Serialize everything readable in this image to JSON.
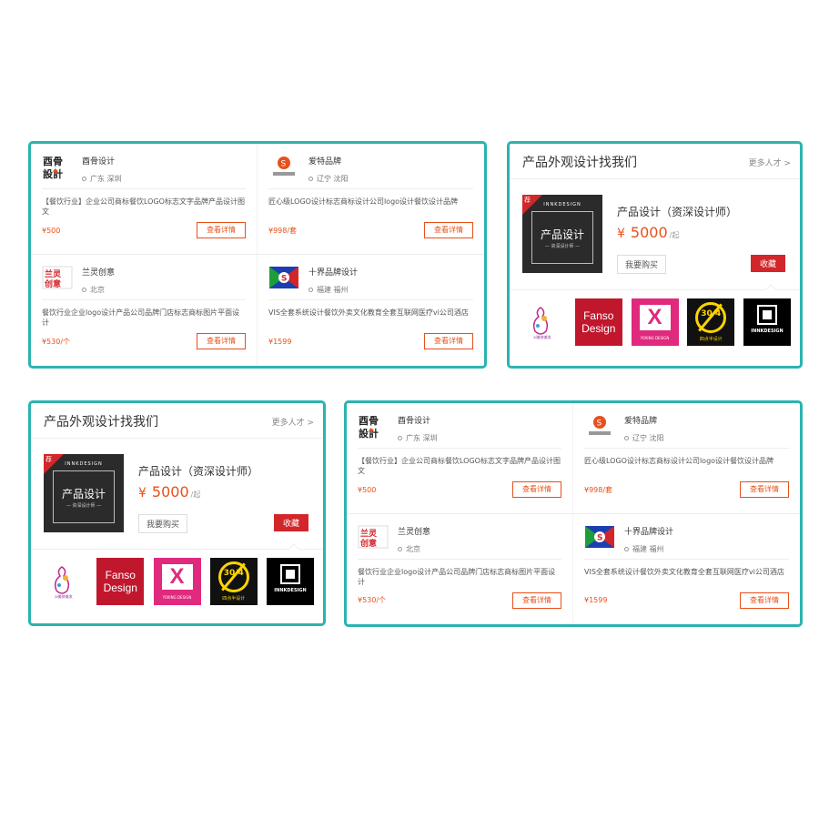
{
  "providers": [
    {
      "name": "酉骨设计",
      "location": "广东 深圳",
      "desc": "【餐饮行业】企业公司商标餐饮LOGO标志文字品牌产品设计图文",
      "price": "¥500",
      "button": "查看详情",
      "logo": "yougu-logo"
    },
    {
      "name": "爱特品牌",
      "location": "辽宁 沈阳",
      "desc": "匠心级LOGO设计标志商标设计公司logo设计餐饮设计品牌",
      "price": "¥998/套",
      "button": "查看详情",
      "logo": "aite-logo"
    },
    {
      "name": "兰灵创意",
      "location": "北京",
      "desc": "餐饮行业企业logo设计产品公司品牌门店标志商标图片平面设计",
      "price": "¥530/个",
      "button": "查看详情",
      "logo": "lanling-logo"
    },
    {
      "name": "十界品牌设计",
      "location": "福建 福州",
      "desc": "VIS全套系统设计餐饮外卖文化教育全套互联网医疗vi公司酒店",
      "price": "¥1599",
      "button": "查看详情",
      "logo": "shijie-logo"
    }
  ],
  "product_card": {
    "title": "产品外观设计找我们",
    "more": "更多人才 >",
    "thumb_tag": "荐",
    "thumb_brand": "INNKDESIGN",
    "thumb_main": "产品设计",
    "thumb_sub": "— 资深设计师 —",
    "name": "产品设计（资深设计师）",
    "price_symbol": "¥",
    "price_value": "5000",
    "price_unit": "/起",
    "buy_label": "我要购买",
    "fav_label": "收藏",
    "logo_fanso_line1": "Fanso",
    "logo_fanso_line2": "Design",
    "logo_x_letter": "X",
    "logo_x_sub": "YOXING DESIGN",
    "logo_304_num": "30/4",
    "logo_304_sub": "四点半设计",
    "logo_inn": "INNKDESIGN",
    "logo_girl_caption": "ai美修美发"
  },
  "colors": {
    "frame": "#2bb3b1",
    "price": "#e8501a",
    "fav": "#d2262a"
  }
}
